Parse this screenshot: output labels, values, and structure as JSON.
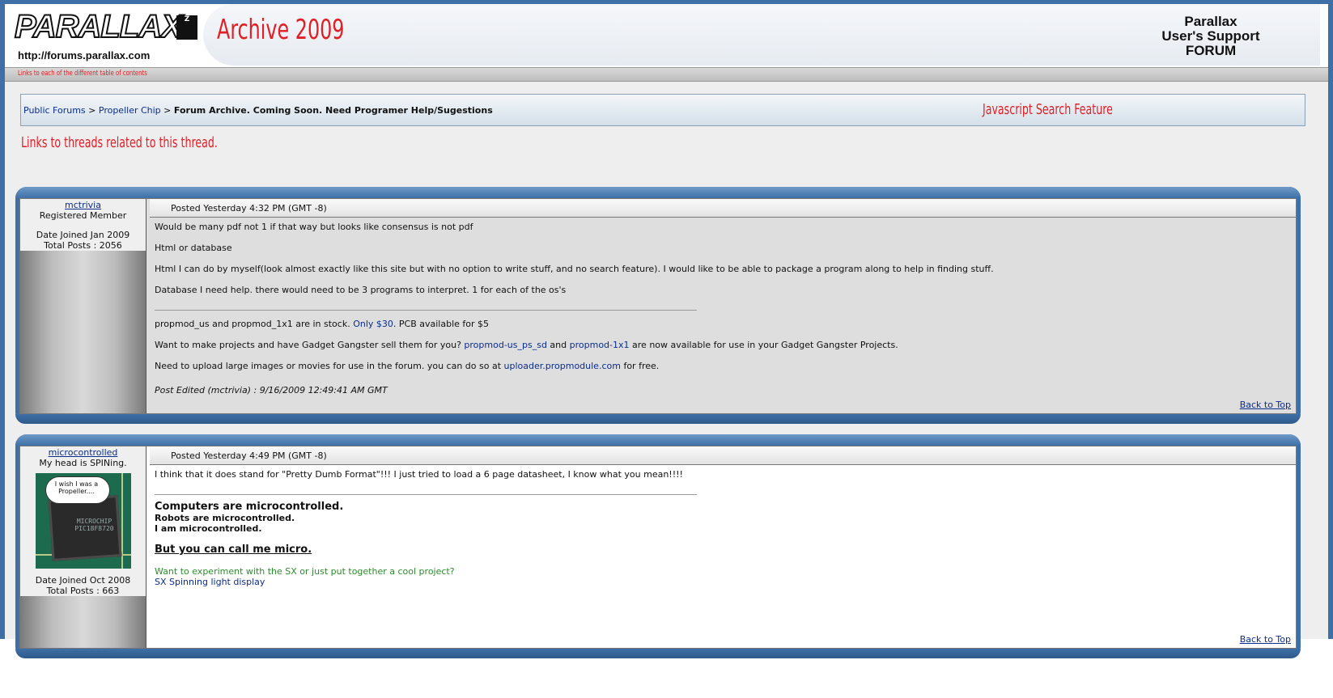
{
  "header": {
    "logo_text": "PARALLAX",
    "logo_badge": "Z",
    "logo_url": "http://forums.parallax.com",
    "archive_title": "Archive 2009",
    "forum_title_lines": [
      "Parallax",
      "User's Support",
      "FORUM"
    ]
  },
  "toc": {
    "link_text": "Links to each of the different table of contents"
  },
  "breadcrumb": {
    "items": [
      "Public Forums",
      "Propeller Chip"
    ],
    "separator": ">",
    "current": "Forum Archive. Coming Soon. Need Programer Help/Sugestions"
  },
  "search_feature": "Javascript Search Feature",
  "related_threads_link": "Links to threads related to this thread.",
  "posts": [
    {
      "author": "mctrivia",
      "rank": "Registered Member",
      "joined": "Date Joined Jan 2009",
      "total_posts": "Total Posts : 2056",
      "posted": "Posted Yesterday 4:32 PM (GMT -8)",
      "paragraphs": [
        "Would be many pdf not 1 if that way but looks like consensus is not pdf",
        "Html or database",
        "Html I can do by myself(look almost exactly like this site but with no option to write stuff, and no search feature). I would like to be able to package a program along to help in finding stuff.",
        "Database I need help. there would need to be 3 programs to interpret. 1 for each of the os's"
      ],
      "sig": {
        "line1_pre": "propmod_us and propmod_1x1 are in stock. ",
        "line1_link": "Only $30",
        "line1_post": ". PCB available for $5",
        "line2_pre": "Want to make projects and have Gadget Gangster sell them for you? ",
        "line2_link1": "propmod-us_ps_sd",
        "line2_mid": " and ",
        "line2_link2": "propmod-1x1",
        "line2_post": " are now available for use in your Gadget Gangster Projects.",
        "line3_pre": "Need to upload large images or movies for use in the forum. you can do so at ",
        "line3_link": "uploader.propmodule.com",
        "line3_post": " for free."
      },
      "edited": "Post Edited (mctrivia) : 9/16/2009 12:49:41 AM GMT",
      "back_to_top": "Back to Top"
    },
    {
      "author": "microcontrolled",
      "rank": "My head is SPINing.",
      "avatar_bubble": "I wish I was a Propeller....",
      "avatar_chip_label": "MICROCHIP PIC18F8720",
      "joined": "Date Joined Oct 2008",
      "total_posts": "Total Posts : 663",
      "posted": "Posted Yesterday 4:49 PM (GMT -8)",
      "paragraphs": [
        "I think that it does stand for \"Pretty Dumb Format\"!!! I just tried to load a 6 page datasheet, I know what you mean!!!!"
      ],
      "sig": {
        "big": "Computers are microcontrolled.",
        "line2": "Robots are microcontrolled.",
        "line3": "I am microcontrolled.",
        "underline": "But you can call me micro.",
        "green": "Want to experiment with the SX or just put together a cool project?",
        "blue_link": "SX Spinning light display"
      },
      "back_to_top": "Back to Top"
    }
  ],
  "colors": {
    "frame_blue": "#3e6fa6",
    "accent_red": "#e02027",
    "link_blue": "#0b2d8c",
    "green_text": "#2e8b2e"
  }
}
